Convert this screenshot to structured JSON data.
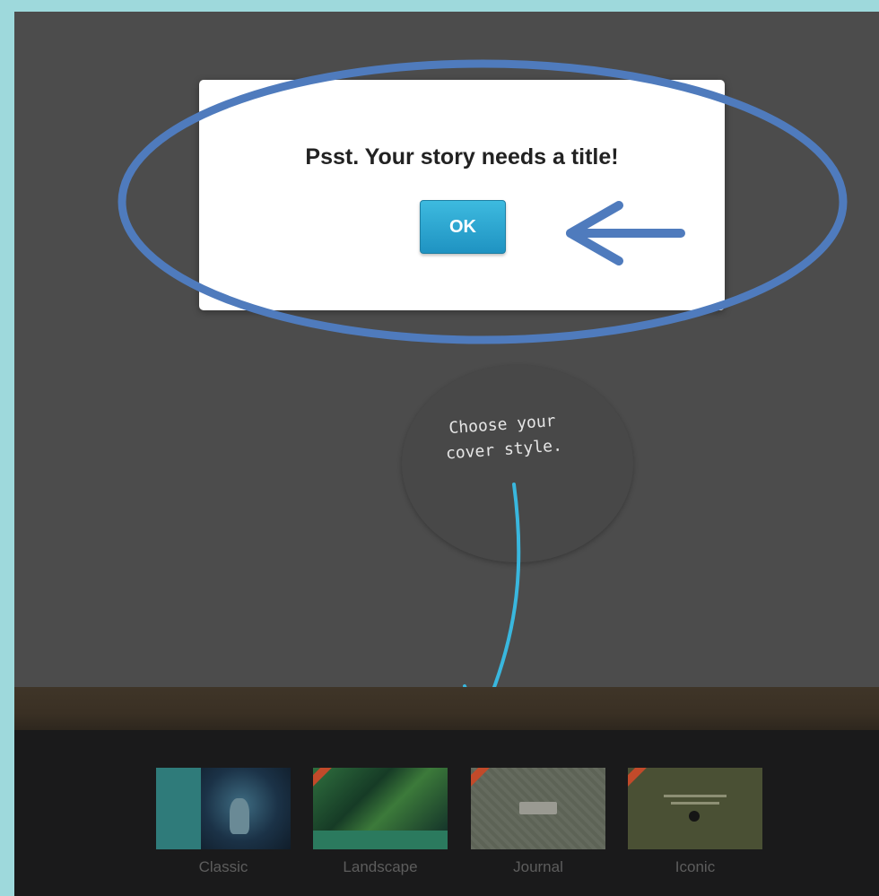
{
  "dialog": {
    "message": "Psst. Your story needs a title!",
    "ok_label": "OK"
  },
  "cover_hint": {
    "line1": "Choose your",
    "line2": "cover style."
  },
  "cover_styles": [
    {
      "label": "Classic"
    },
    {
      "label": "Landscape"
    },
    {
      "label": "Journal"
    },
    {
      "label": "Iconic"
    }
  ],
  "colors": {
    "page_border": "#9ed9dc",
    "overlay": "#4c4c4c",
    "annotation": "#4f7bbd",
    "ok_button": "#2aa7d2",
    "hint_arrow": "#39b7de"
  }
}
